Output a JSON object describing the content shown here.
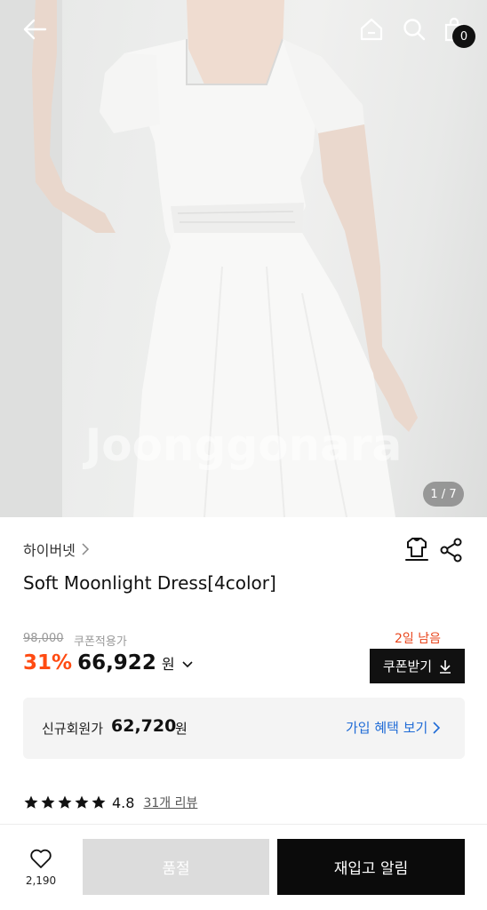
{
  "gallery": {
    "watermark": "Joonggonara",
    "counter": "1 / 7",
    "cart_count": "0"
  },
  "product": {
    "seller": "하이버넷",
    "title": "Soft Moonlight Dress[4color]",
    "original_price": "98,000",
    "coupon_note": "쿠폰적용가",
    "days_left": "2일 남음",
    "discount": "31%",
    "price": "66,922",
    "currency": "원",
    "coupon_button": "쿠폰받기"
  },
  "member": {
    "label": "신규회원가",
    "price": "62,720",
    "currency": "원",
    "benefit_link": "가입 혜택 보기"
  },
  "reviews": {
    "stars": 5,
    "rating": "4.8",
    "review_link": "31개 리뷰"
  },
  "bottom": {
    "like_count": "2,190",
    "soldout_label": "품절",
    "restock_label": "재입고 알림"
  },
  "colors": {
    "accent_red": "#ff4b12",
    "link_blue": "#1f6bd6",
    "dark": "#111111"
  }
}
